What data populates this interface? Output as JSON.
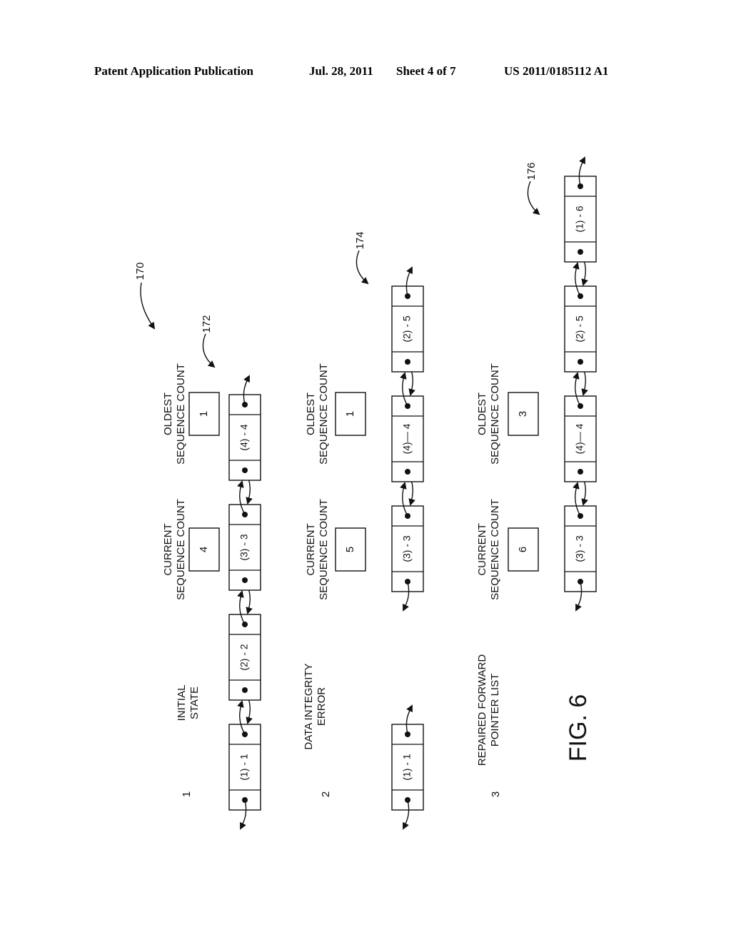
{
  "header": {
    "title": "Patent Application Publication",
    "date": "Jul. 28, 2011",
    "sheet": "Sheet 4 of 7",
    "pub_number": "US 2011/0185112 A1"
  },
  "figure": {
    "label": "FIG. 6",
    "ref_main": "170",
    "sections": [
      {
        "index": "1",
        "caption": [
          "INITIAL",
          "STATE"
        ],
        "ref": "172",
        "current_label": [
          "CURRENT",
          "SEQUENCE COUNT"
        ],
        "current_value": "4",
        "oldest_label": [
          "OLDEST",
          "SEQUENCE COUNT"
        ],
        "oldest_value": "1",
        "chains": [
          [
            "(1) - 1",
            "(2) - 2",
            "(3) - 3",
            "(4) - 4"
          ]
        ]
      },
      {
        "index": "2",
        "caption": [
          "DATA INTEGRITY",
          "ERROR"
        ],
        "ref": "174",
        "current_label": [
          "CURRENT",
          "SEQUENCE COUNT"
        ],
        "current_value": "5",
        "oldest_label": [
          "OLDEST",
          "SEQUENCE COUNT"
        ],
        "oldest_value": "1",
        "chains": [
          [
            "(1) - 1"
          ],
          [
            "(3) - 3",
            "(4)— 4",
            "(2) - 5"
          ]
        ]
      },
      {
        "index": "3",
        "caption": [
          "REPAIRED FORWARD",
          "POINTER LIST"
        ],
        "ref": "176",
        "current_label": [
          "CURRENT",
          "SEQUENCE COUNT"
        ],
        "current_value": "6",
        "oldest_label": [
          "OLDEST",
          "SEQUENCE COUNT"
        ],
        "oldest_value": "3",
        "chains": [
          [
            "(3) - 3",
            "(4)— 4",
            "(2) - 5",
            "(1) - 6"
          ]
        ]
      }
    ]
  }
}
